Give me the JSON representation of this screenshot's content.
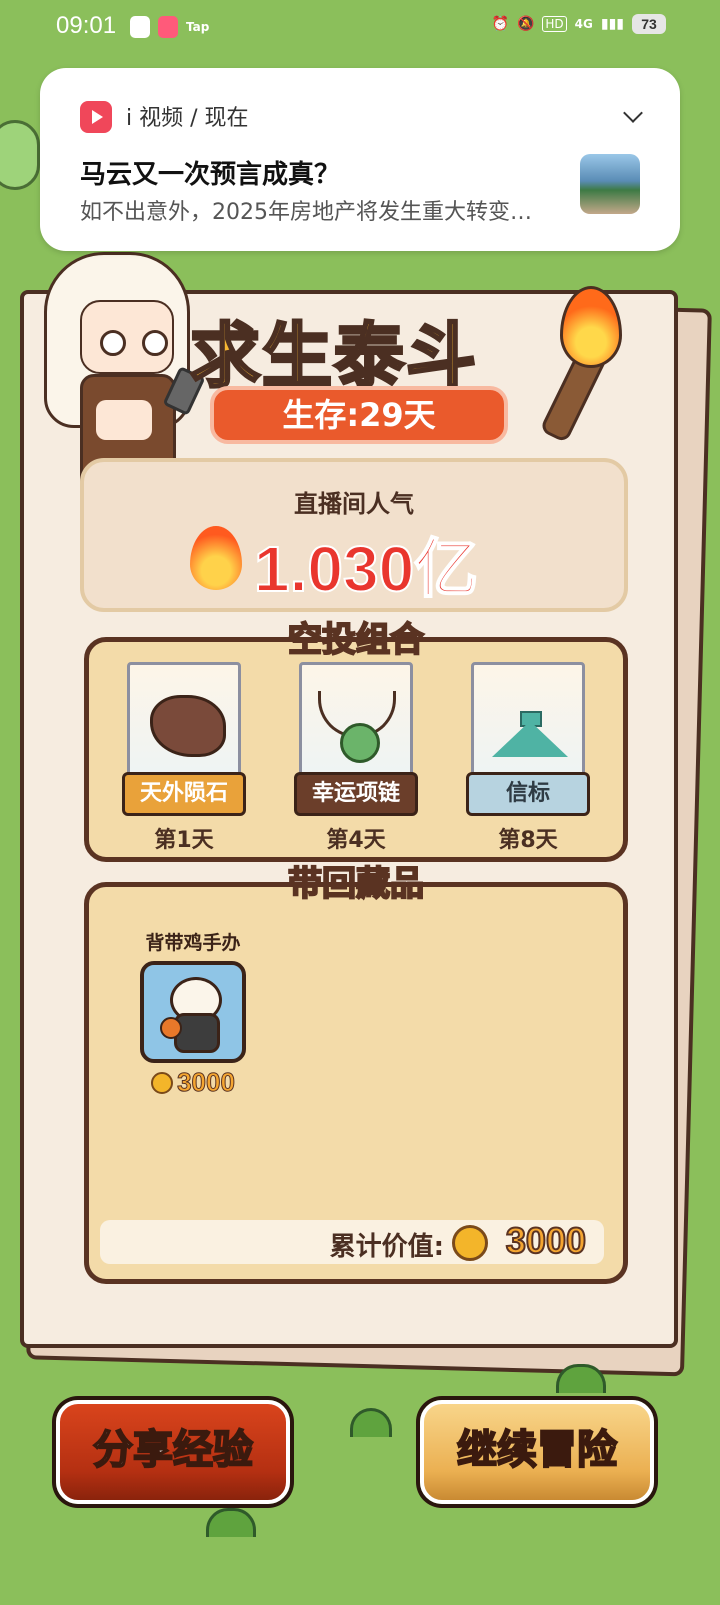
{
  "status_bar": {
    "time": "09:01",
    "app_badges": [
      "video-app-icon",
      "bilibili-icon",
      "taptap-icon"
    ],
    "taptap_text": "Tap",
    "network": "4G",
    "hd_label": "HD",
    "battery": "73"
  },
  "notification": {
    "app_name": "i 视频 / 现在",
    "title": "马云又一次预言成真？",
    "body": "如不出意外，2025年房地产将发生重大转变…"
  },
  "game": {
    "title": "求生泰斗",
    "survival_days": "生存:29天",
    "popularity_label": "直播间人气",
    "popularity_value": "1.030亿",
    "airdrop_title": "空投组合",
    "airdrops": [
      {
        "name": "天外陨石",
        "day": "第1天",
        "icon": "meteorite-icon",
        "label_color": "#e9a23a"
      },
      {
        "name": "幸运项链",
        "day": "第4天",
        "icon": "necklace-icon",
        "label_color": "#6b3e2a"
      },
      {
        "name": "信标",
        "day": "第8天",
        "icon": "beacon-icon",
        "label_color": "#b7d3e0"
      }
    ],
    "collection_title": "带回藏品",
    "collection": [
      {
        "name": "背带鸡手办",
        "price": "3000",
        "icon": "chicken-figure-icon"
      }
    ],
    "total_label": "累计价值:",
    "total_value": "3000"
  },
  "buttons": {
    "share": "分享经验",
    "continue": "继续冒险"
  },
  "colors": {
    "background": "#8bbf5b",
    "title": "#f6b733",
    "days_pill": "#ea5a2c",
    "popularity": "#e9362e",
    "coin": "#f3b52a",
    "share_button": "#c2361a",
    "continue_button": "#ebb052"
  }
}
